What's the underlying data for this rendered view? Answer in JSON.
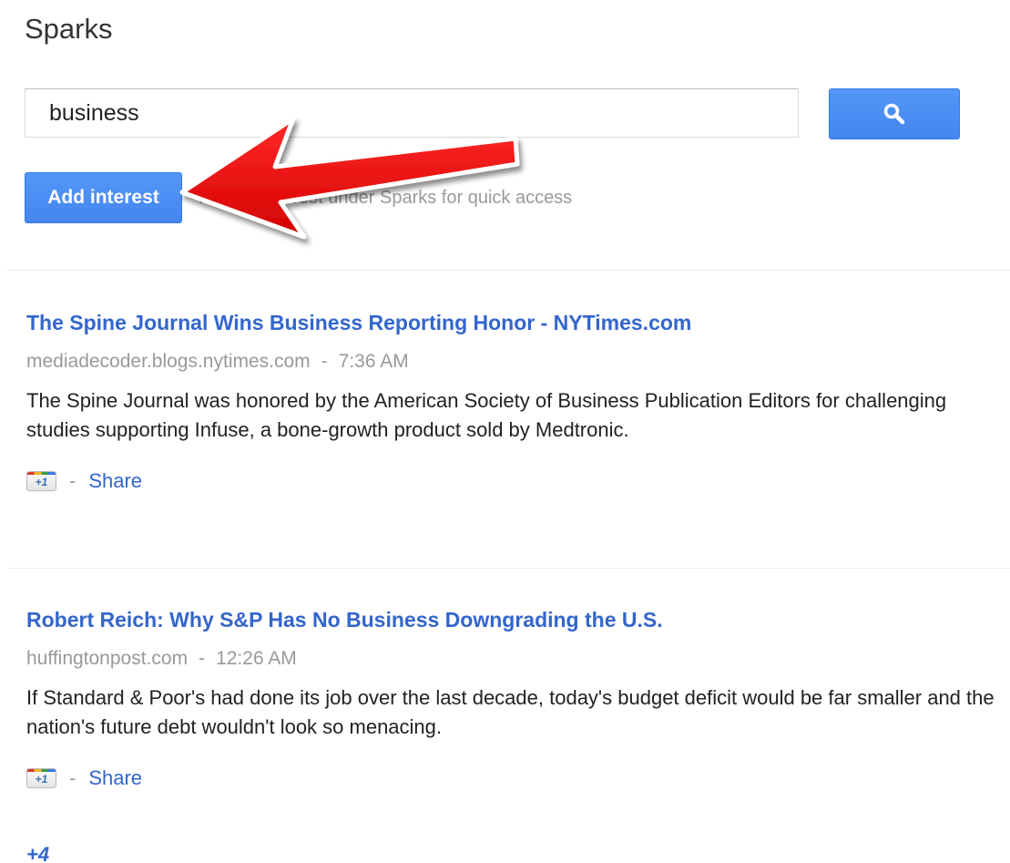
{
  "page": {
    "title": "Sparks"
  },
  "search": {
    "value": "business",
    "button_icon": "search-icon"
  },
  "interest": {
    "add_label": "Add interest",
    "hint": "Pin this interest under Sparks for quick access"
  },
  "articles": [
    {
      "title": "The Spine Journal Wins Business Reporting Honor - NYTimes.com",
      "source": "mediadecoder.blogs.nytimes.com",
      "separator": "-",
      "time": "7:36 AM",
      "snippet": "The Spine Journal was honored by the American Society of Business Publication Editors for challenging studies supporting Infuse, a bone-growth product sold by Medtronic.",
      "plusone_label": "+1",
      "action_separator": "-",
      "share_label": "Share"
    },
    {
      "title": "Robert Reich: Why S&P Has No Business Downgrading the U.S.",
      "source": "huffingtonpost.com",
      "separator": "-",
      "time": "12:26 AM",
      "snippet": "If Standard & Poor's had done its job over the last decade, today's budget deficit would be far smaller and the nation's future debt wouldn't look so menacing.",
      "plusone_label": "+1",
      "action_separator": "-",
      "share_label": "Share"
    }
  ],
  "footer": {
    "more_count": "+4"
  },
  "colors": {
    "accent_blue": "#4d90fe",
    "link_blue": "#3366cc",
    "annotation_red": "#e8000b"
  }
}
